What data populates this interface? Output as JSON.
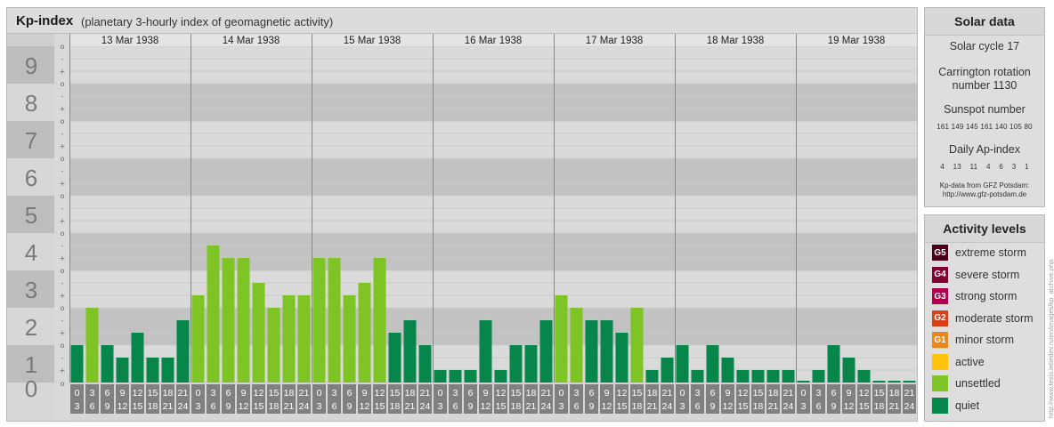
{
  "header": {
    "title": "Kp-index",
    "subtitle": "(planetary 3-hourly index of geomagnetic activity)"
  },
  "chart_data": {
    "type": "bar",
    "title": "Kp-index",
    "subtitle": "(planetary 3-hourly index of geomagnetic activity)",
    "ylim": [
      0,
      9
    ],
    "y_ticks": [
      "0",
      "1",
      "2",
      "3",
      "4",
      "5",
      "6",
      "7",
      "8",
      "9"
    ],
    "minor_ticks": [
      "+",
      "o",
      "-"
    ],
    "days": [
      "13 Mar 1938",
      "14 Mar 1938",
      "15 Mar 1938",
      "16 Mar 1938",
      "17 Mar 1938",
      "18 Mar 1938",
      "19 Mar 1938"
    ],
    "interval_start": [
      "0",
      "3",
      "6",
      "9",
      "12",
      "15",
      "18",
      "21"
    ],
    "interval_end": [
      "3",
      "6",
      "9",
      "12",
      "15",
      "18",
      "21",
      "24"
    ],
    "values": [
      1.0,
      2.0,
      1.0,
      0.667,
      1.333,
      0.667,
      0.667,
      1.667,
      2.333,
      3.667,
      3.333,
      3.333,
      2.667,
      2.0,
      2.333,
      2.333,
      3.333,
      3.333,
      2.333,
      2.667,
      3.333,
      1.333,
      1.667,
      1.0,
      0.333,
      0.333,
      0.333,
      1.667,
      0.333,
      1.0,
      1.0,
      1.667,
      2.333,
      2.0,
      1.667,
      1.667,
      1.333,
      2.0,
      0.333,
      0.667,
      1.0,
      0.333,
      1.0,
      0.667,
      0.333,
      0.333,
      0.333,
      0.333,
      0.0,
      0.333,
      1.0,
      0.667,
      0.333,
      0.0,
      0.0,
      0.0
    ],
    "legend": [
      {
        "badge": "G5",
        "label": "extreme storm",
        "color": "#4d0019"
      },
      {
        "badge": "G4",
        "label": "severe storm",
        "color": "#800033"
      },
      {
        "badge": "G3",
        "label": "strong storm",
        "color": "#b3004d"
      },
      {
        "badge": "G2",
        "label": "moderate storm",
        "color": "#d9401a"
      },
      {
        "badge": "G1",
        "label": "minor storm",
        "color": "#e8871c"
      },
      {
        "badge": "",
        "label": "active",
        "color": "#fec10e"
      },
      {
        "badge": "",
        "label": "unsettled",
        "color": "#7fc425"
      },
      {
        "badge": "",
        "label": "quiet",
        "color": "#07864b"
      }
    ]
  },
  "solar": {
    "title": "Solar data",
    "cycle": "Solar cycle 17",
    "carrington_line1": "Carrington rotation",
    "carrington_line2": "number 1130",
    "sunspot_title": "Sunspot number",
    "sunspot_values": "161 149 145 161 140 105 80",
    "ap_title": "Daily Ap-index",
    "ap_values": "4    13    11    4    6    3    1",
    "source_line1": "Kp-data from GFZ Potsdam:",
    "source_line2": "http://www.gfz-potsdam.de"
  },
  "levels": {
    "title": "Activity levels"
  },
  "credit": "http://www.tesis.lebedev.ru/en/images/kp_archive.php",
  "colors": {
    "quiet": "#07864b",
    "unsettled": "#7fc425",
    "active": "#fec10e",
    "band_dark": "#c2c2c2",
    "band_light": "#dadada",
    "x_tile": "#808080"
  }
}
